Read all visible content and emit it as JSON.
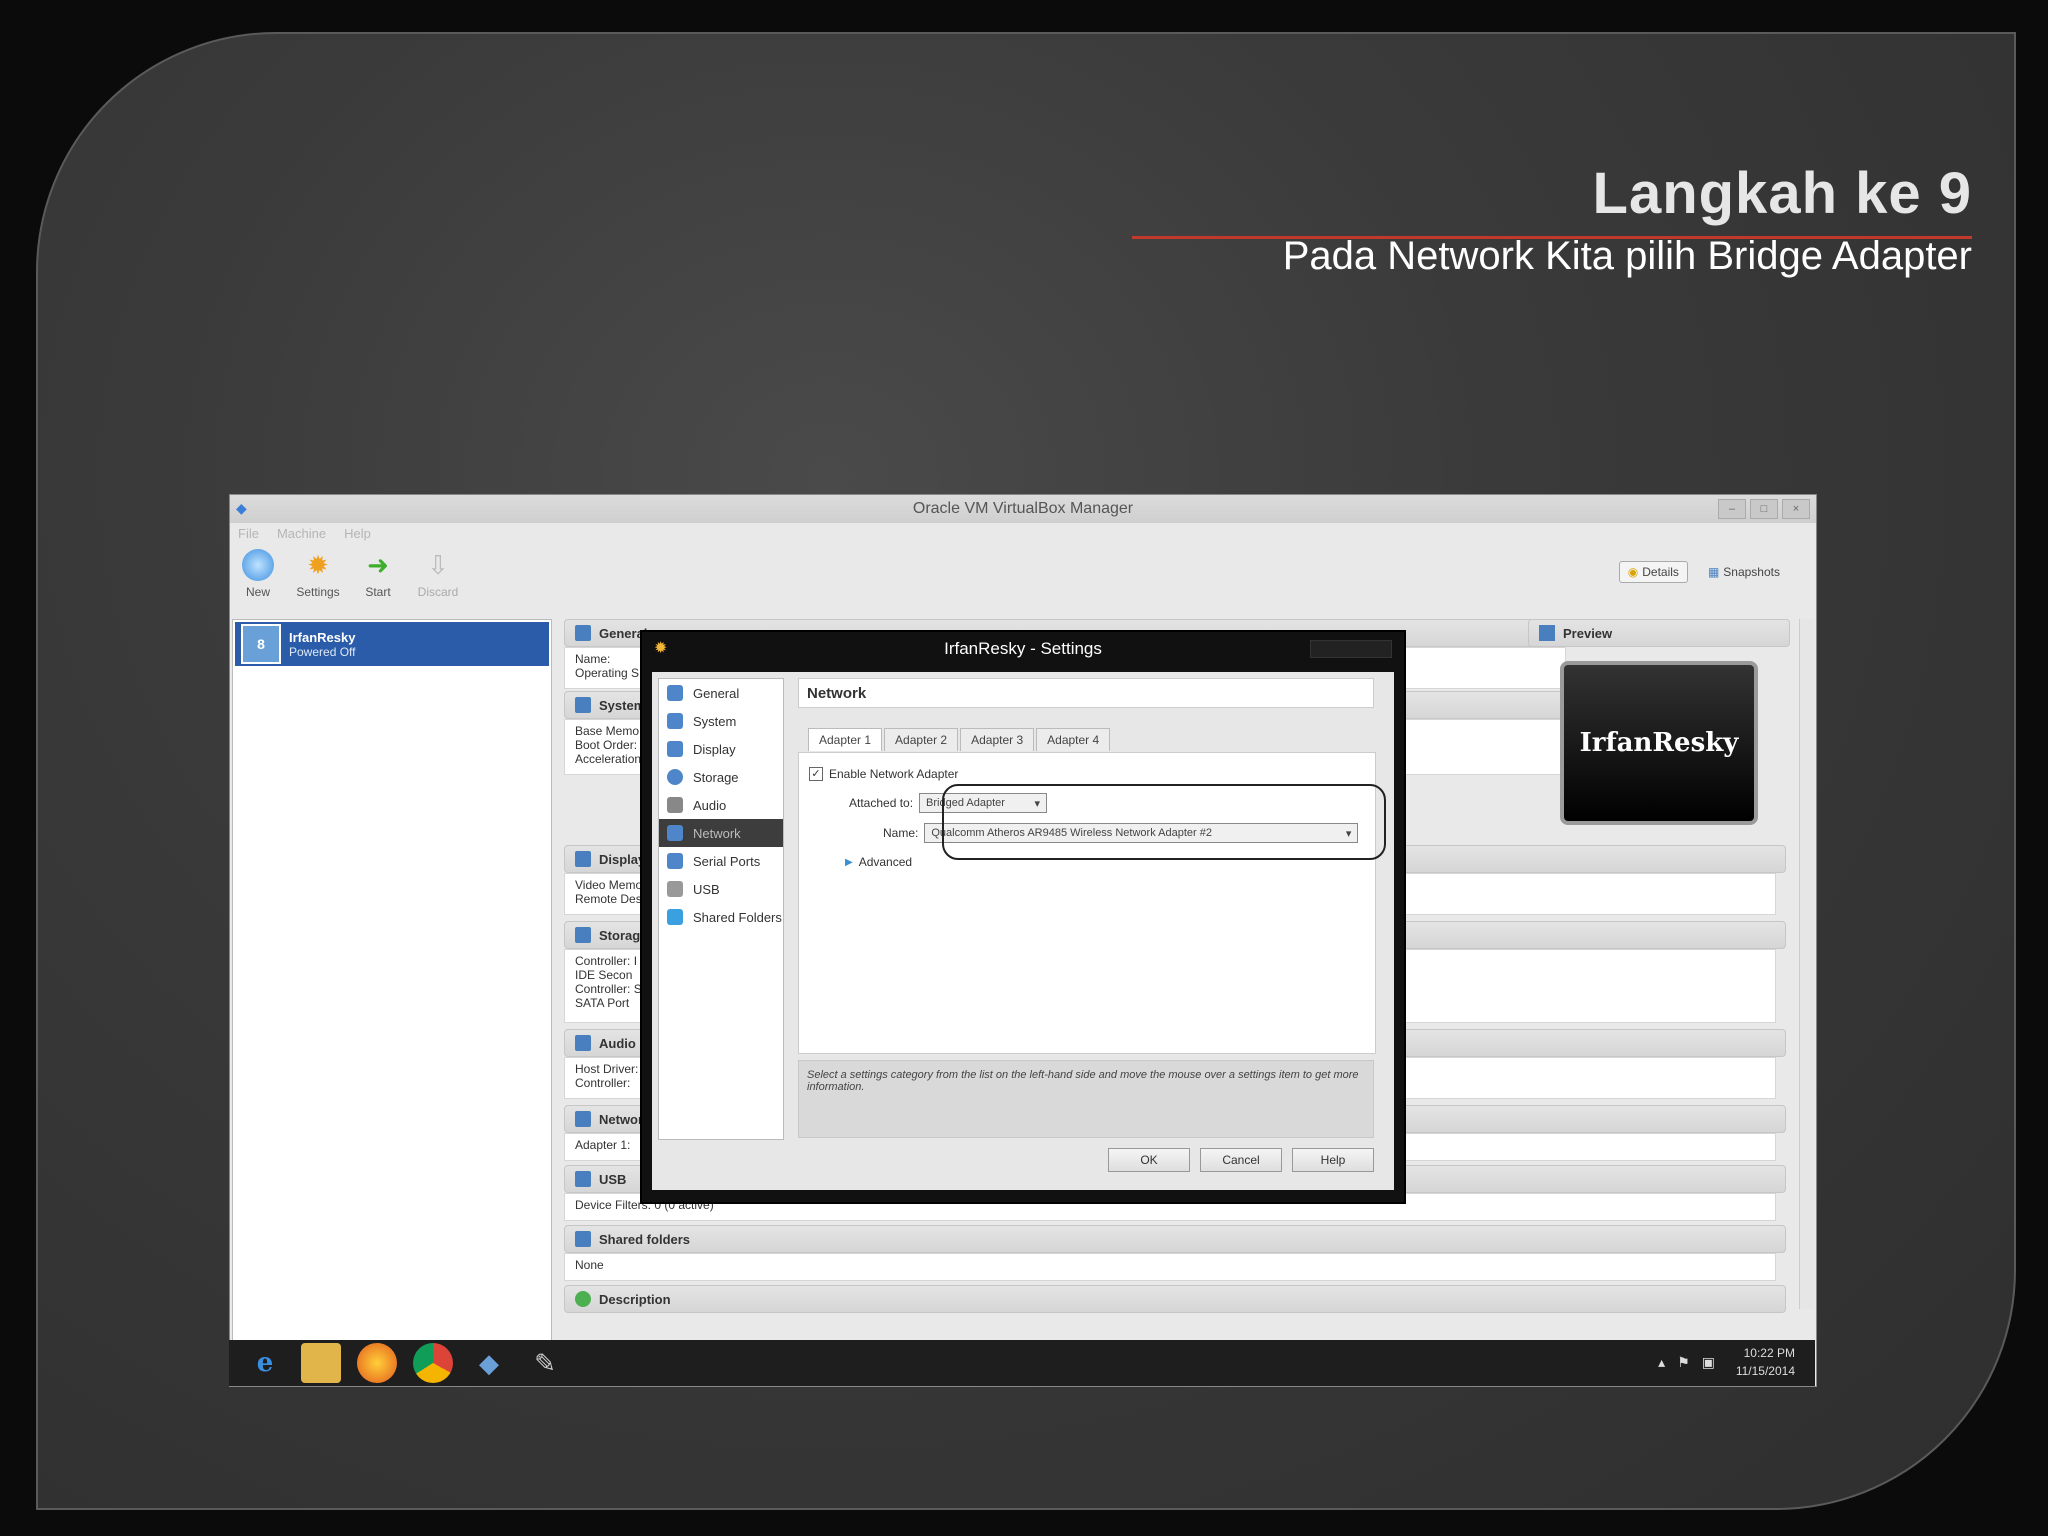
{
  "slide": {
    "title": "Langkah ke 9",
    "subtitle": "Pada Network Kita pilih Bridge Adapter"
  },
  "vbox": {
    "title": "Oracle VM VirtualBox Manager",
    "menu": [
      "File",
      "Machine",
      "Help"
    ],
    "toolbar": {
      "new": "New",
      "settings": "Settings",
      "start": "Start",
      "discard": "Discard",
      "details": "Details",
      "snapshots": "Snapshots"
    },
    "vm": {
      "name": "IrfanResky",
      "state": "Powered Off"
    },
    "sections": {
      "general": {
        "head": "General",
        "body": [
          "Name:",
          "Operating S"
        ]
      },
      "system": {
        "head": "System",
        "body": [
          "Base Memo",
          "Boot Order:",
          "Acceleration"
        ]
      },
      "display": {
        "head": "Display",
        "body": [
          "Video Memo",
          "Remote Des"
        ]
      },
      "storage": {
        "head": "Storage",
        "body": [
          "Controller: I",
          "IDE Secon",
          "Controller: S",
          "SATA Port"
        ]
      },
      "audio": {
        "head": "Audio",
        "body": [
          "Host Driver:",
          "Controller:"
        ]
      },
      "network": {
        "head": "Network",
        "body": [
          "Adapter 1:"
        ]
      },
      "usb": {
        "head": "USB",
        "body": [
          "Device Filters:    0 (0 active)"
        ]
      },
      "shared": {
        "head": "Shared folders",
        "body": [
          "None"
        ]
      },
      "description": {
        "head": "Description"
      }
    },
    "preview": {
      "head": "Preview",
      "screen": "IrfanResky"
    }
  },
  "dialog": {
    "title": "IrfanResky - Settings",
    "categories": [
      "General",
      "System",
      "Display",
      "Storage",
      "Audio",
      "Network",
      "Serial Ports",
      "USB",
      "Shared Folders"
    ],
    "panel_title": "Network",
    "tabs": [
      "Adapter 1",
      "Adapter 2",
      "Adapter 3",
      "Adapter 4"
    ],
    "enable_label": "Enable Network Adapter",
    "attached_label": "Attached to:",
    "attached_value": "Bridged Adapter",
    "name_label": "Name:",
    "name_value": "Qualcomm Atheros AR9485 Wireless Network Adapter #2",
    "advanced_label": "Advanced",
    "info_text": "Select a settings category from the list on the left-hand side and move the mouse over a settings item to get more information.",
    "ok": "OK",
    "cancel": "Cancel",
    "help": "Help"
  },
  "taskbar": {
    "time": "10:22 PM",
    "date": "11/15/2014"
  }
}
